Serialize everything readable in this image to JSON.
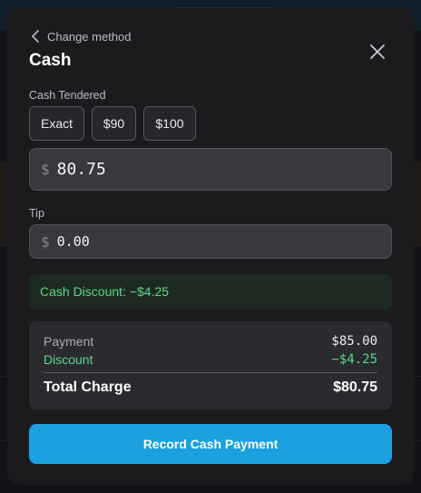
{
  "modal": {
    "back_label": "Change method",
    "title": "Cash",
    "cash_tendered_label": "Cash Tendered",
    "quick_amounts": [
      "Exact",
      "$90",
      "$100"
    ],
    "currency_symbol": "$",
    "cash_tendered_value": "80.75",
    "tip_label": "Tip",
    "tip_value": "0.00",
    "discount_banner": "Cash Discount: −$4.25",
    "summary": {
      "payment_label": "Payment",
      "payment_value": "$85.00",
      "discount_label": "Discount",
      "discount_value": "−$4.25",
      "total_label": "Total Charge",
      "total_value": "$80.75"
    },
    "primary_button": "Record Cash Payment"
  },
  "colors": {
    "accent": "#1aa1e0",
    "discount_green": "#5fd68a",
    "modal_bg": "#1b1b1e"
  },
  "icons": {
    "back": "chevron-left-icon",
    "close": "close-icon"
  }
}
